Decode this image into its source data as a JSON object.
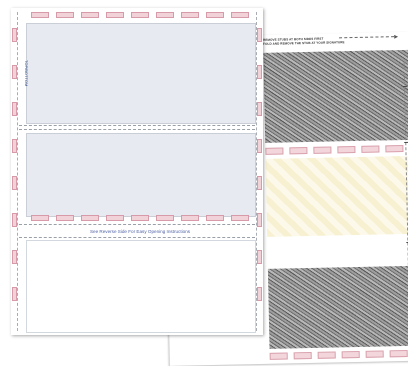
{
  "front_sheet": {
    "vertical_label": "TOP/BOTTOM",
    "opening_instructions": "See Reverse Side For Easy Opening Instructions",
    "tab_colors": {
      "fill": "#f2d2d9",
      "border": "#d79aa8"
    },
    "stub_color": "#e7ebf1"
  },
  "back_sheet": {
    "instructions_line1": "REMOVE STUBS AT BOTH SIDES FIRST",
    "instructions_line2": "FOLD AND REMOVE THE STUB AT YOUR SIGNATURE"
  }
}
